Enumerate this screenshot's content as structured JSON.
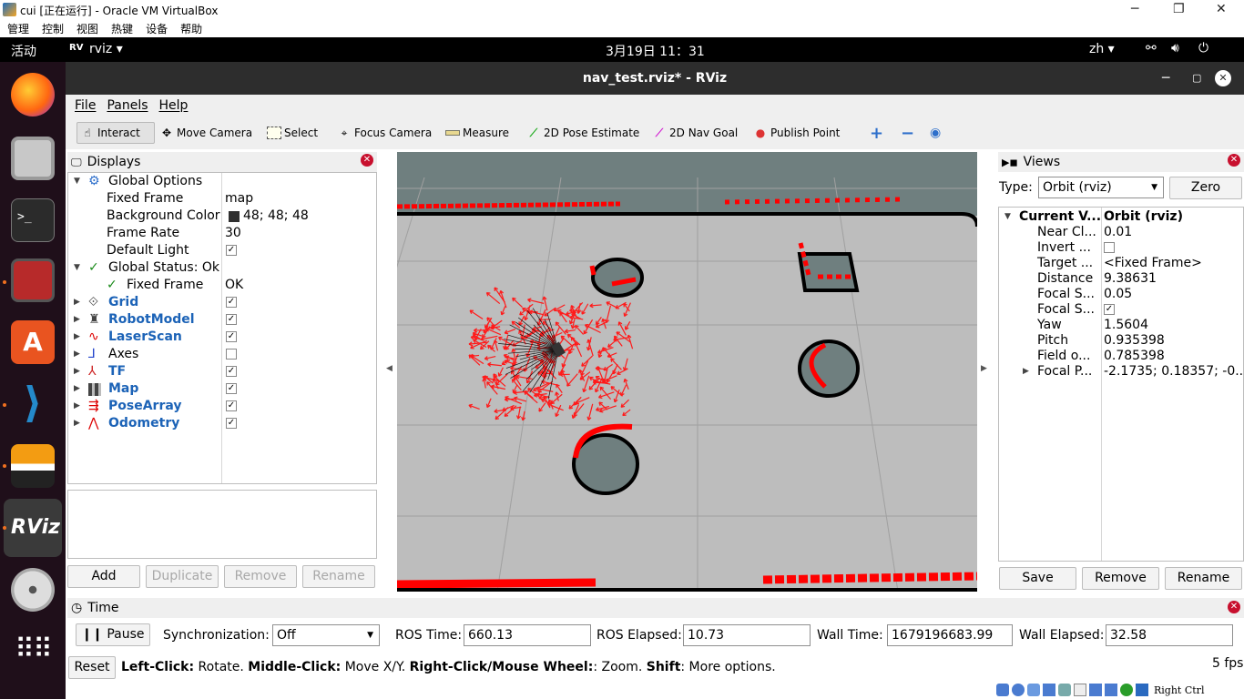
{
  "vbox": {
    "title": "cui [正在运行] - Oracle VM VirtualBox",
    "menu": [
      "管理",
      "控制",
      "视图",
      "热键",
      "设备",
      "帮助"
    ],
    "ctl_min": "─",
    "ctl_max": "❐",
    "ctl_close": "✕",
    "host_key": "Right Ctrl"
  },
  "gnome": {
    "activities": "活动",
    "app_name": "rviz ▾",
    "clock": "3月19日  11：31",
    "lang": "zh ▾"
  },
  "rviz": {
    "title": "nav_test.rviz* - RViz",
    "menu": [
      "File",
      "Panels",
      "Help"
    ],
    "tools": [
      "Interact",
      "Move Camera",
      "Select",
      "Focus Camera",
      "Measure",
      "2D Pose Estimate",
      "2D Nav Goal",
      "Publish Point"
    ],
    "displays": {
      "title": "Displays",
      "rows": [
        {
          "name": "Global Options",
          "value": ""
        },
        {
          "name": "Fixed Frame",
          "value": "map"
        },
        {
          "name": "Background Color",
          "value": "48; 48; 48"
        },
        {
          "name": "Frame Rate",
          "value": "30"
        },
        {
          "name": "Default Light",
          "value": ""
        },
        {
          "name": "Global Status: Ok",
          "value": ""
        },
        {
          "name": "Fixed Frame",
          "value": "OK"
        },
        {
          "name": "Grid",
          "value": ""
        },
        {
          "name": "RobotModel",
          "value": ""
        },
        {
          "name": "LaserScan",
          "value": ""
        },
        {
          "name": "Axes",
          "value": ""
        },
        {
          "name": "TF",
          "value": ""
        },
        {
          "name": "Map",
          "value": ""
        },
        {
          "name": "PoseArray",
          "value": ""
        },
        {
          "name": "Odometry",
          "value": ""
        }
      ],
      "buttons": [
        "Add",
        "Duplicate",
        "Remove",
        "Rename"
      ]
    },
    "views": {
      "title": "Views",
      "type_label": "Type:",
      "type_value": "Orbit (rviz)",
      "zero": "Zero",
      "rows": [
        {
          "name": "Current V...",
          "value": "Orbit (rviz)"
        },
        {
          "name": "Near Cl...",
          "value": "0.01"
        },
        {
          "name": "Invert ...",
          "value": ""
        },
        {
          "name": "Target ...",
          "value": "<Fixed Frame>"
        },
        {
          "name": "Distance",
          "value": "9.38631"
        },
        {
          "name": "Focal S...",
          "value": "0.05"
        },
        {
          "name": "Focal S...",
          "value": ""
        },
        {
          "name": "Yaw",
          "value": "1.5604"
        },
        {
          "name": "Pitch",
          "value": "0.935398"
        },
        {
          "name": "Field o...",
          "value": "0.785398"
        },
        {
          "name": "Focal P...",
          "value": "-2.1735; 0.18357; -0...."
        }
      ],
      "buttons": [
        "Save",
        "Remove",
        "Rename"
      ]
    },
    "time": {
      "title": "Time",
      "pause": "Pause",
      "sync_label": "Synchronization:",
      "sync_value": "Off",
      "ros_time_label": "ROS Time:",
      "ros_time": "660.13",
      "ros_elapsed_label": "ROS Elapsed:",
      "ros_elapsed": "10.73",
      "wall_time_label": "Wall Time:",
      "wall_time": "1679196683.99",
      "wall_elapsed_label": "Wall Elapsed:",
      "wall_elapsed": "32.58"
    },
    "status": {
      "reset": "Reset",
      "b1": "Left-Click:",
      "t1": " Rotate. ",
      "b2": "Middle-Click:",
      "t2": " Move X/Y. ",
      "b3": "Right-Click/Mouse Wheel:",
      "t3": ": Zoom. ",
      "b4": "Shift",
      "t4": ": More options.",
      "fps": "5 fps"
    }
  },
  "colors": {
    "accent": "#c8102e",
    "link": "#1c63b7",
    "laser": "#ff0000",
    "map_free": "#bdbdbd",
    "map_unknown": "#6f7f7f"
  }
}
